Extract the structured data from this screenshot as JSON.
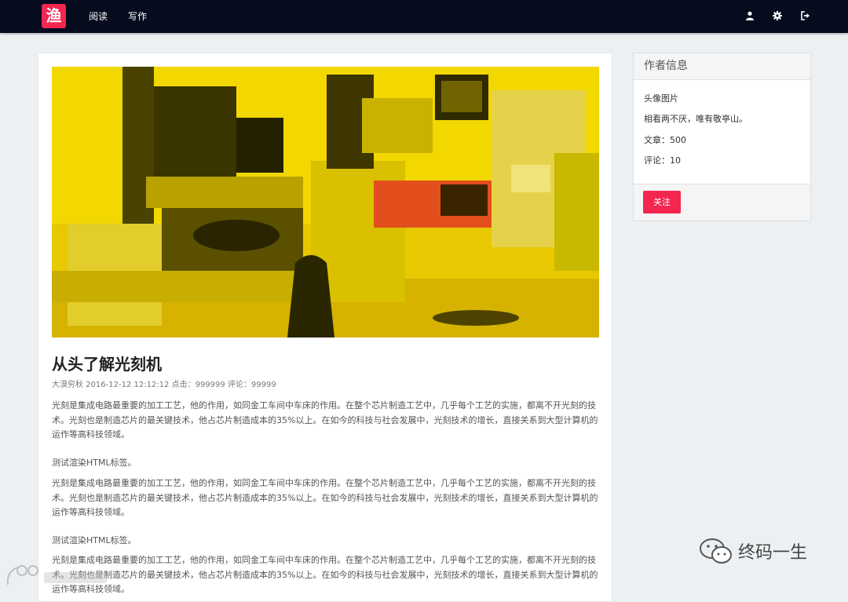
{
  "nav": {
    "logo": "渔",
    "links": [
      "阅读",
      "写作"
    ],
    "icons": [
      "user-icon",
      "gear-icon",
      "sign-out-icon"
    ]
  },
  "article": {
    "title": "从头了解光刻机",
    "meta": "大漠穷秋 2016-12-12 12:12:12 点击：999999 评论：99999",
    "paragraph": "光刻是集成电路最重要的加工工艺，他的作用，如同金工车间中车床的作用。在整个芯片制造工艺中，几乎每个工艺的实施，都离不开光刻的技术。光刻也是制造芯片的最关键技术，他占芯片制造成本的35%以上。在如今的科技与社会发展中，光刻技术的增长，直接关系到大型计算机的运作等高科技领域。",
    "test_line": "测试渲染HTML标签。"
  },
  "author_panel": {
    "title": "作者信息",
    "avatar_label": "头像图片",
    "motto": "相看两不厌，唯有敬亭山。",
    "articles": "文章：500",
    "comments": "评论：10",
    "follow_label": "关注"
  },
  "watermark": {
    "text": "终码一生"
  },
  "colors": {
    "accent": "#f3264f",
    "navbar": "#060b1e",
    "background": "#edf0f2"
  }
}
